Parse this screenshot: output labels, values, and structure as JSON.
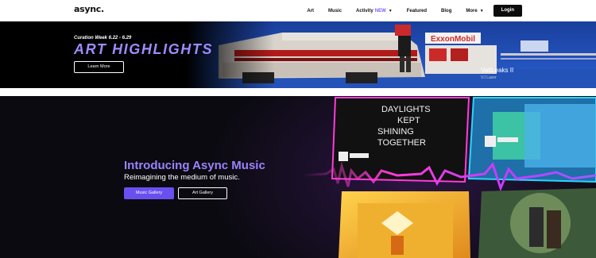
{
  "nav": {
    "logo": "async.",
    "links": [
      {
        "label": "Art"
      },
      {
        "label": "Music"
      },
      {
        "label": "Activity",
        "badge": "NEW"
      },
      {
        "label": "Featured"
      },
      {
        "label": "Blog"
      },
      {
        "label": "More"
      }
    ],
    "login": "Login"
  },
  "hero1": {
    "curation": "Curation Week 6.22 - 6.29",
    "title": "ART HIGHLIGHTS",
    "cta": "Learn More",
    "artwork_title": "VatiLeaks II",
    "artwork_author": "VJ Lazer",
    "sign_text": "ExxonMobil"
  },
  "hero2": {
    "title": "Introducing Async Music",
    "subtitle": "Reimagining the medium of music.",
    "music_gallery": "Music Gallery",
    "art_gallery": "Art Gallery",
    "cover_text": [
      "DAYLIGHTS",
      "KEPT",
      "SHINING",
      "TOGETHER"
    ]
  },
  "colors": {
    "accent": "#9c82ff",
    "button_purple": "#6a4ff0",
    "nav_new": "#7b61ff"
  }
}
